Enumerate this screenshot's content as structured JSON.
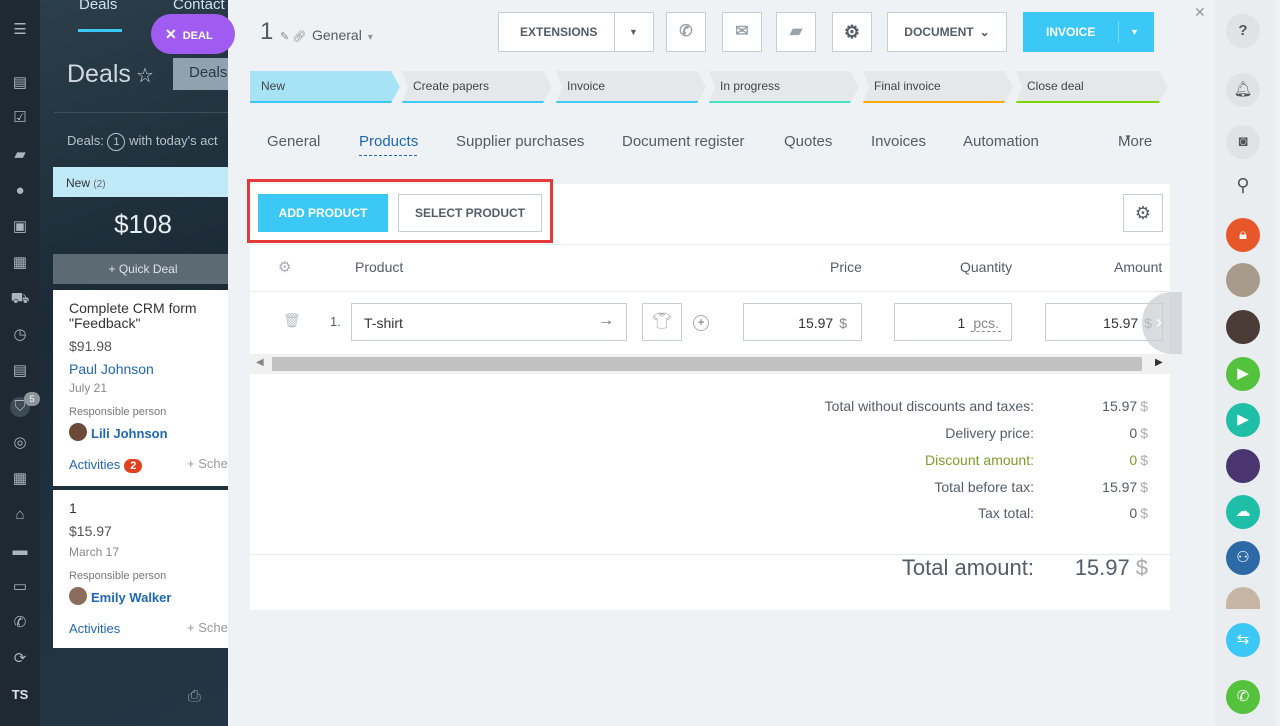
{
  "left_nav": {
    "user_initials": "TS",
    "filter_badge": "5"
  },
  "background": {
    "tabs": [
      "Deals",
      "Contact"
    ],
    "deal_badge": "DEAL",
    "page_title": "Deals",
    "deals_button": "Deals",
    "deals_line_prefix": "Deals:",
    "deals_line_count": "1",
    "deals_line_suffix": "with today's act",
    "column_name": "New",
    "column_count": "(2)",
    "column_sum": "$108",
    "quick_deal": "+ Quick Deal",
    "cards": [
      {
        "title1": "Complete CRM form",
        "title2": "\"Feedback\"",
        "price": "$91.98",
        "contact": "Paul Johnson",
        "date": "July 21",
        "resp_label": "Responsible person",
        "resp_name": "Lili Johnson",
        "activities": "Activities",
        "activities_count": "2",
        "schedule": "+ Sche"
      },
      {
        "title1": "1",
        "price": "$15.97",
        "date": "March 17",
        "resp_label": "Responsible person",
        "resp_name": "Emily Walker",
        "activities": "Activities",
        "schedule": "+ Sche"
      }
    ]
  },
  "deal": {
    "number": "1",
    "category": "General",
    "buttons": {
      "extensions": "EXTENSIONS",
      "document": "DOCUMENT",
      "invoice": "INVOICE"
    },
    "stages": [
      {
        "label": "New",
        "color": "#a7e3f6",
        "line": "#3bc8f5"
      },
      {
        "label": "Create papers",
        "color": "#e5e8ea",
        "line": "#3bc8f5"
      },
      {
        "label": "Invoice",
        "color": "#e5e8ea",
        "line": "#3bc8f5"
      },
      {
        "label": "In progress",
        "color": "#e5e8ea",
        "line": "#47e4c2"
      },
      {
        "label": "Final invoice",
        "color": "#e5e8ea",
        "line": "#ffa900"
      },
      {
        "label": "Close deal",
        "color": "#e5e8ea",
        "line": "#7bd500"
      }
    ],
    "tabs": [
      "General",
      "Products",
      "Supplier purchases",
      "Document register",
      "Quotes",
      "Invoices",
      "Automation",
      "More"
    ],
    "active_tab": "Products"
  },
  "products": {
    "add_button": "ADD PRODUCT",
    "select_button": "SELECT PRODUCT",
    "columns": {
      "product": "Product",
      "price": "Price",
      "quantity": "Quantity",
      "amount": "Amount"
    },
    "rows": [
      {
        "index": "1.",
        "name": "T-shirt",
        "price": "15.97",
        "currency": "$",
        "quantity": "1",
        "unit": "pcs.",
        "amount": "15.97"
      }
    ],
    "totals": [
      {
        "label": "Total without discounts and taxes:",
        "value": "15.97",
        "currency": "$"
      },
      {
        "label": "Delivery price:",
        "value": "0",
        "currency": "$"
      },
      {
        "label": "Discount amount:",
        "value": "0",
        "currency": "$"
      },
      {
        "label": "Total before tax:",
        "value": "15.97",
        "currency": "$"
      },
      {
        "label": "Tax total:",
        "value": "0",
        "currency": "$"
      }
    ],
    "grand_total": {
      "label": "Total amount:",
      "value": "15.97",
      "currency": "$"
    }
  }
}
